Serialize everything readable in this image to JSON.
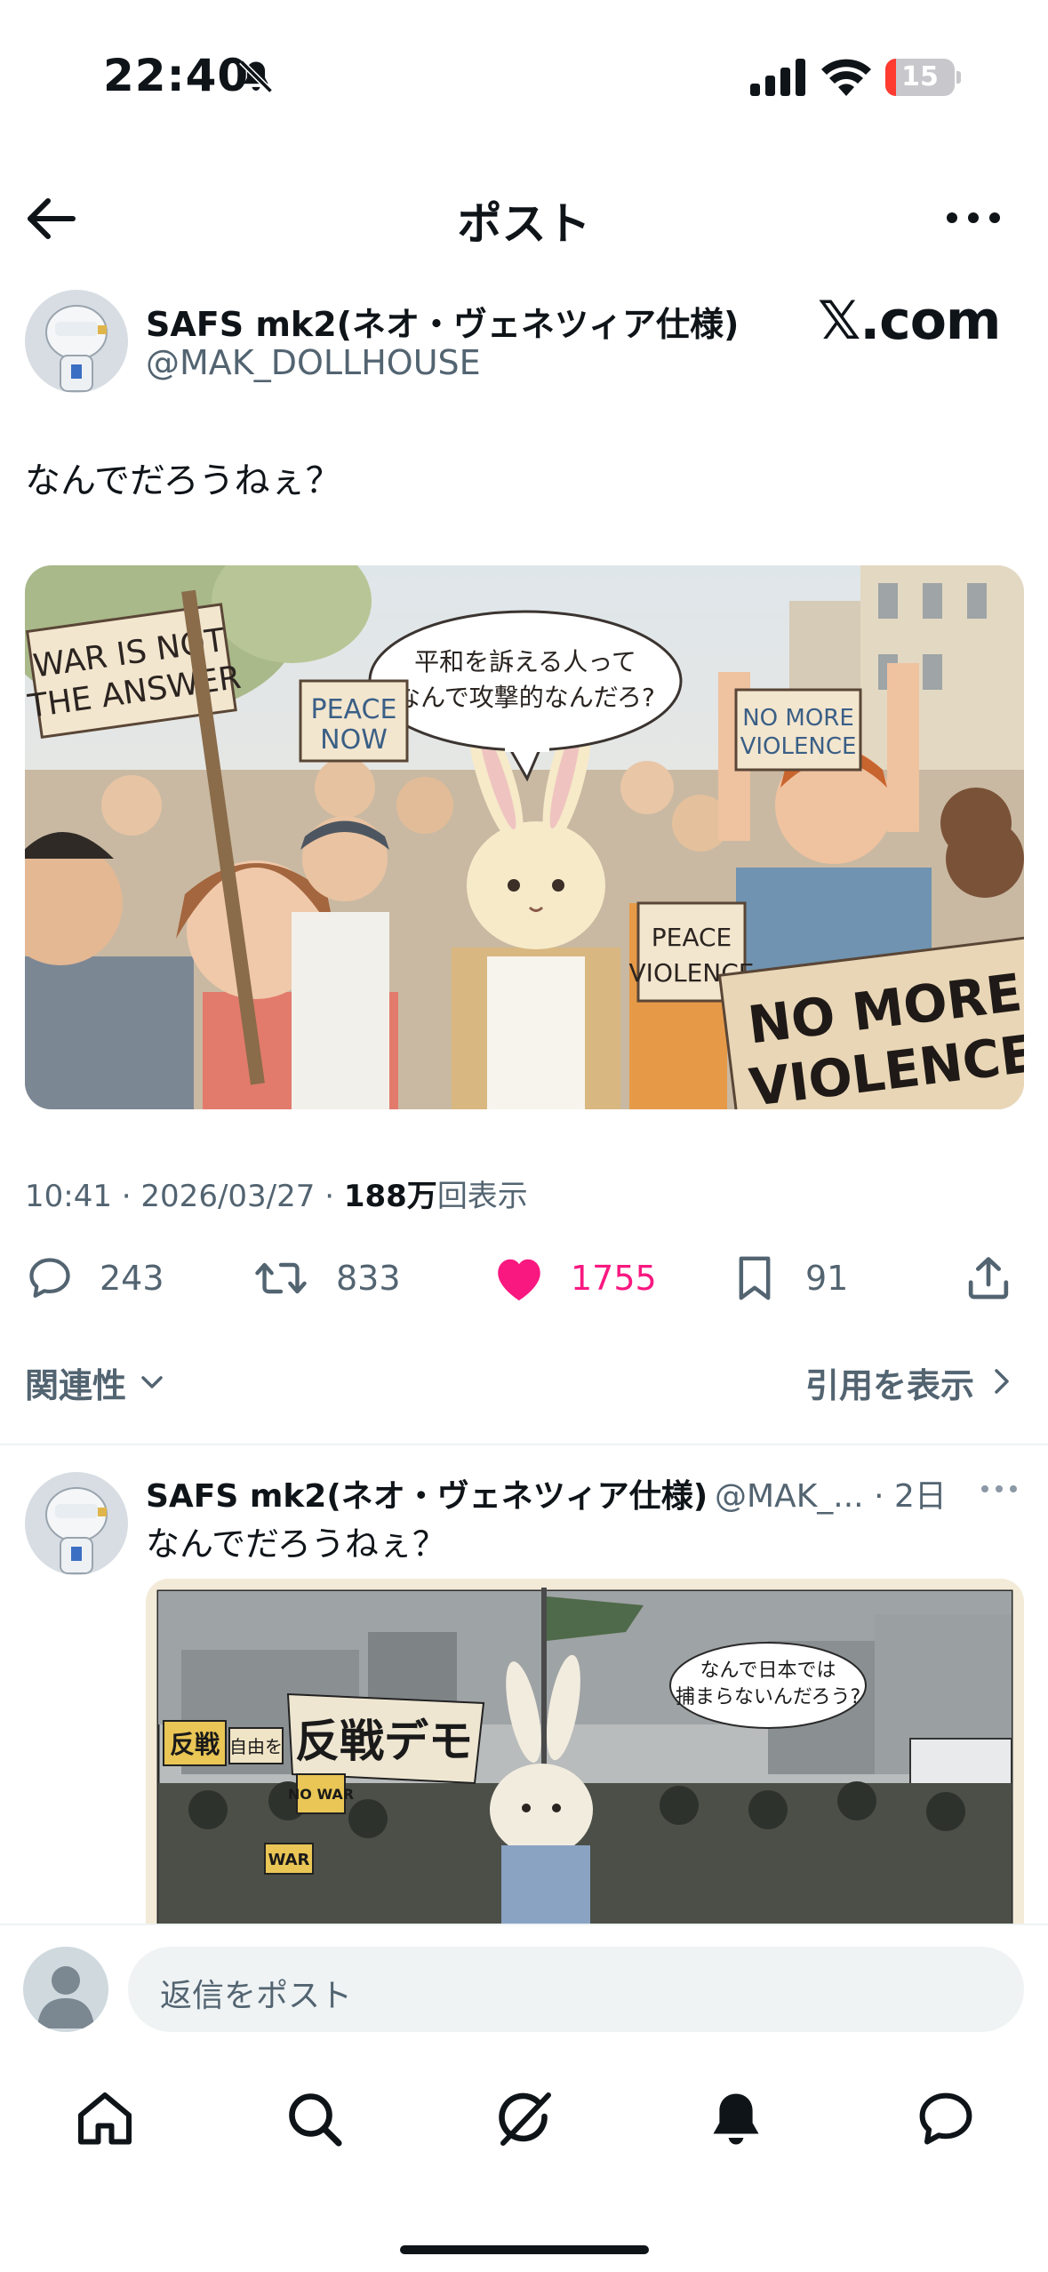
{
  "status_bar": {
    "time": "22:40",
    "battery": "15",
    "battery_level": 0.15
  },
  "header": {
    "title": "ポスト"
  },
  "post": {
    "author_name": "SAFS mk2(ネオ・ヴェネツィア仕様)",
    "author_handle": "@MAK_DOLLHOUSE",
    "watermark": "𝕏.com",
    "text": "なんでだろうねぇ？",
    "image": {
      "sign_left": "WAR IS NOT THE ANSWER",
      "sign_peace_now": "PEACE NOW",
      "sign_no_more_small": "NO MORE VIOLENCE",
      "sign_peace_violence": "PEACE VIOLENCE",
      "sign_no_more_violence": "NO MORE VIOLENCE",
      "bubble": "平和を訴える人って\nなんで攻撃的なんだろ?"
    },
    "time": "10:41",
    "date": "2026/03/27",
    "views_count": "188万",
    "views_label": "回表示",
    "sep": " · "
  },
  "actions": {
    "replies": "243",
    "reposts": "833",
    "likes": "1755",
    "bookmarks": "91"
  },
  "replies_section": {
    "sort_label": "関連性",
    "quotes_link": "引用を表示"
  },
  "reply": {
    "author_name": "SAFS mk2(ネオ・ヴェネツィア仕様)",
    "handle_time": "@MAK_... · 2日",
    "text": "なんでだろうねぇ？",
    "image": {
      "banner": "反戦デモ",
      "sign_1": "反戦",
      "sign_2": "自由を",
      "sign_3": "NO WAR",
      "sign_4": "WAR",
      "bubble": "なんで日本では\n捕まらないんだろう?"
    }
  },
  "composer": {
    "placeholder": "返信をポスト"
  },
  "colors": {
    "like": "#f91880",
    "secondary": "#536471",
    "text": "#0f1419"
  }
}
